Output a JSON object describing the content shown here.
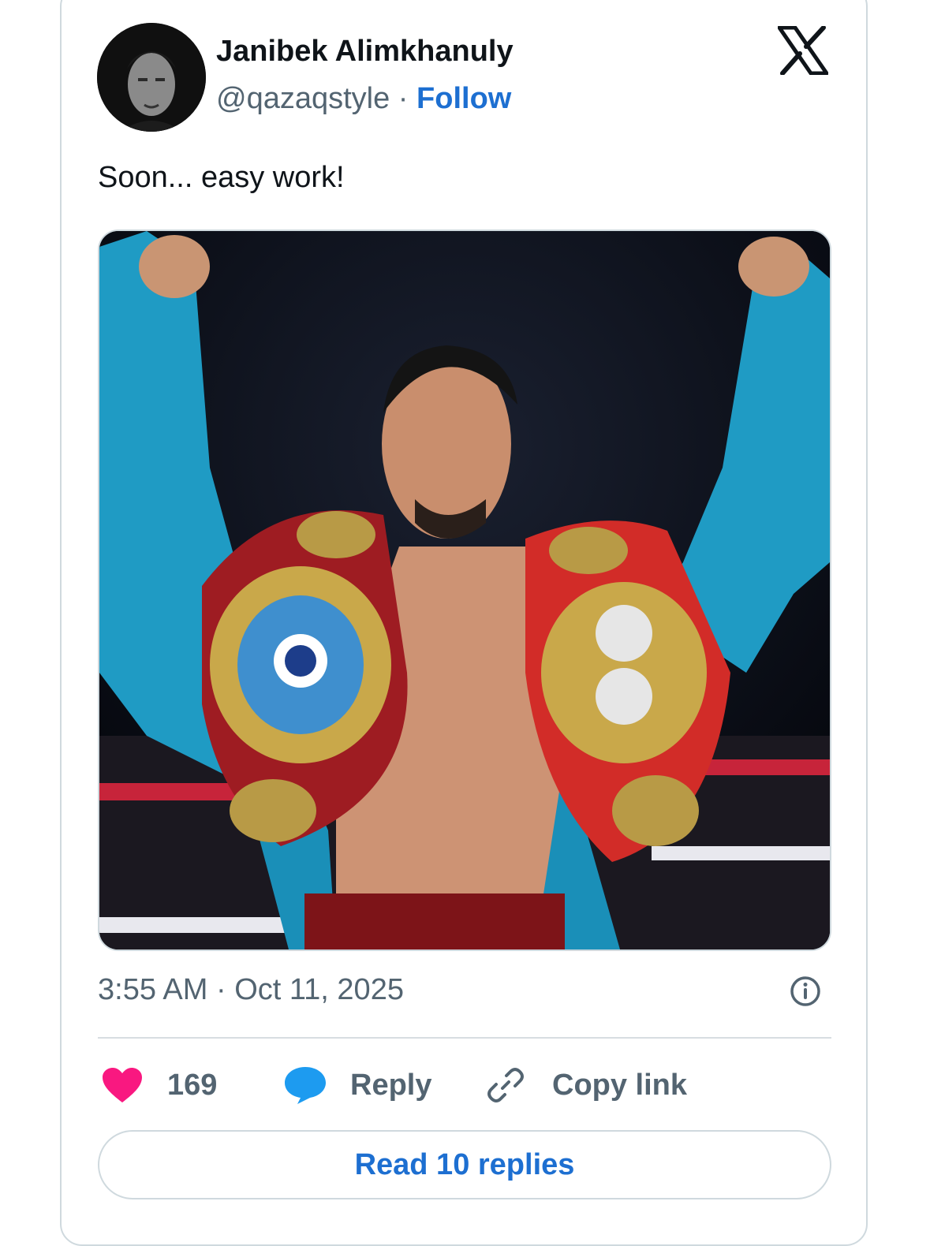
{
  "author": {
    "name": "Janibek Alimkhanuly",
    "handle": "@qazaqstyle",
    "separator": " · ",
    "follow_label": "Follow"
  },
  "tweet": {
    "text": "Soon... easy work!",
    "timestamp": "3:55 AM · Oct 11, 2025"
  },
  "actions": {
    "like_count": "169",
    "reply_label": "Reply",
    "copy_link_label": "Copy link"
  },
  "read_replies_label": "Read 10 replies",
  "colors": {
    "like": "#f91880",
    "reply_bubble": "#1d9bf0",
    "link": "#1d6fd1",
    "muted_text": "#536471"
  },
  "icons": {
    "brand": "x-logo-icon",
    "info": "info-icon",
    "like": "heart-icon",
    "reply": "speech-bubble-icon",
    "copy": "link-icon"
  }
}
